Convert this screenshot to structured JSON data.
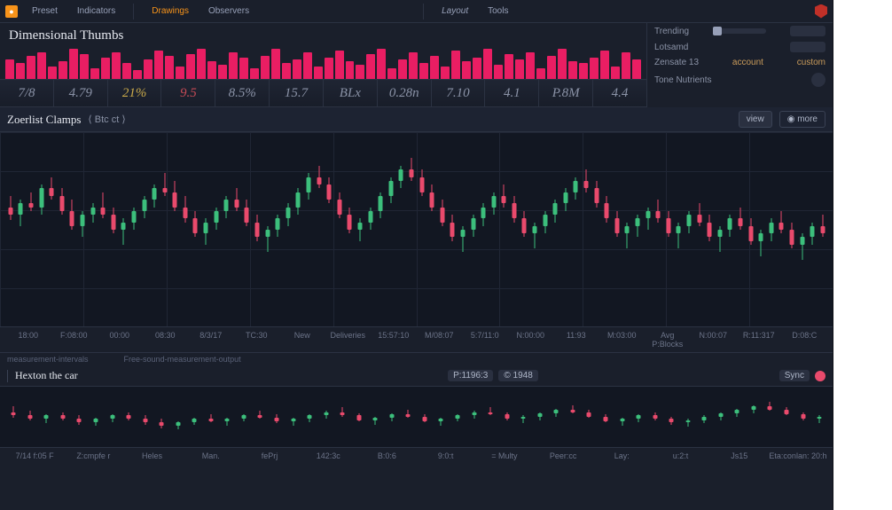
{
  "nav": {
    "items": [
      "Preset",
      "Indicators",
      "Drawings",
      "Observers"
    ],
    "right": [
      "Layout",
      "Tools"
    ]
  },
  "title": "Dimensional Thumbs",
  "side": {
    "rows": [
      "Trending",
      "Lotsamd",
      "Zensate 13",
      "Tone Nutrients"
    ],
    "links": [
      "account",
      "custom"
    ]
  },
  "tickers": [
    "7/8",
    "4.79",
    "21%",
    "9.5",
    "8.5%",
    "15.7",
    "BLx",
    "0.28n",
    "7.10",
    "4.1",
    "P.8M",
    "4.4"
  ],
  "toolbar": {
    "title": "Zoerlist Clamps",
    "center": "⟨ Btc ct ⟩",
    "view_btn": "view",
    "more_btn": "◉ more"
  },
  "xlabels": [
    "18:00",
    "F:08:00",
    "00:00",
    "08:30",
    "8/3/17",
    "TC:30",
    "New",
    "Deliveries",
    "15:57:10",
    "M/08:07",
    "5:7/11:0",
    "N:00:00",
    "11:93",
    "M:03:00",
    "Avg P:Blocks",
    "N:00:07",
    "R:11:317",
    "D:08:C"
  ],
  "footnote": {
    "left": "measurement-intervals",
    "right": "Free-sound-measurement-output"
  },
  "sec": {
    "title": "Hexton the car",
    "tags": [
      "P:1196:3",
      "© 1948"
    ],
    "btn": "Sync"
  },
  "bottom_labels": [
    "7/14  f:05  F",
    "Z:cmpfe r",
    "Heles",
    "Man.",
    "fePrj",
    "142:3c",
    "B:0:6",
    "9:0:t",
    "= Multy",
    "Peer:cc",
    "Lay:",
    "u:2:t",
    "Js15",
    "Eta:conlan: 20:h"
  ],
  "chart_data": {
    "histogram": [
      22,
      18,
      26,
      30,
      14,
      20,
      34,
      28,
      12,
      24,
      30,
      18,
      10,
      22,
      32,
      26,
      14,
      28,
      34,
      20,
      16,
      30,
      24,
      12,
      26,
      34,
      18,
      22,
      30,
      14,
      24,
      32,
      20,
      16,
      28,
      34,
      12,
      22,
      30,
      18,
      26,
      14,
      32,
      20,
      24,
      34,
      16,
      28,
      22,
      30,
      12,
      26,
      34,
      20,
      18,
      24,
      32,
      14,
      30,
      22
    ],
    "main_candles": {
      "type": "candlestick",
      "yrange": [
        0,
        100
      ],
      "data": [
        {
          "o": 62,
          "h": 68,
          "l": 55,
          "c": 58,
          "up": false
        },
        {
          "o": 58,
          "h": 66,
          "l": 52,
          "c": 64,
          "up": true
        },
        {
          "o": 64,
          "h": 70,
          "l": 60,
          "c": 62,
          "up": false
        },
        {
          "o": 62,
          "h": 74,
          "l": 58,
          "c": 72,
          "up": true
        },
        {
          "o": 72,
          "h": 78,
          "l": 66,
          "c": 68,
          "up": false
        },
        {
          "o": 68,
          "h": 72,
          "l": 58,
          "c": 60,
          "up": false
        },
        {
          "o": 60,
          "h": 66,
          "l": 50,
          "c": 52,
          "up": false
        },
        {
          "o": 52,
          "h": 60,
          "l": 46,
          "c": 58,
          "up": true
        },
        {
          "o": 58,
          "h": 64,
          "l": 54,
          "c": 62,
          "up": true
        },
        {
          "o": 62,
          "h": 70,
          "l": 56,
          "c": 58,
          "up": false
        },
        {
          "o": 58,
          "h": 62,
          "l": 48,
          "c": 50,
          "up": false
        },
        {
          "o": 50,
          "h": 56,
          "l": 42,
          "c": 54,
          "up": true
        },
        {
          "o": 54,
          "h": 62,
          "l": 50,
          "c": 60,
          "up": true
        },
        {
          "o": 60,
          "h": 68,
          "l": 56,
          "c": 66,
          "up": true
        },
        {
          "o": 66,
          "h": 74,
          "l": 62,
          "c": 72,
          "up": true
        },
        {
          "o": 72,
          "h": 80,
          "l": 68,
          "c": 70,
          "up": false
        },
        {
          "o": 70,
          "h": 76,
          "l": 60,
          "c": 62,
          "up": false
        },
        {
          "o": 62,
          "h": 68,
          "l": 54,
          "c": 56,
          "up": false
        },
        {
          "o": 56,
          "h": 60,
          "l": 46,
          "c": 48,
          "up": false
        },
        {
          "o": 48,
          "h": 56,
          "l": 42,
          "c": 54,
          "up": true
        },
        {
          "o": 54,
          "h": 62,
          "l": 50,
          "c": 60,
          "up": true
        },
        {
          "o": 60,
          "h": 68,
          "l": 56,
          "c": 66,
          "up": true
        },
        {
          "o": 66,
          "h": 72,
          "l": 60,
          "c": 62,
          "up": false
        },
        {
          "o": 62,
          "h": 66,
          "l": 52,
          "c": 54,
          "up": false
        },
        {
          "o": 54,
          "h": 58,
          "l": 44,
          "c": 46,
          "up": false
        },
        {
          "o": 46,
          "h": 52,
          "l": 38,
          "c": 50,
          "up": true
        },
        {
          "o": 50,
          "h": 58,
          "l": 46,
          "c": 56,
          "up": true
        },
        {
          "o": 56,
          "h": 64,
          "l": 52,
          "c": 62,
          "up": true
        },
        {
          "o": 62,
          "h": 72,
          "l": 58,
          "c": 70,
          "up": true
        },
        {
          "o": 70,
          "h": 80,
          "l": 66,
          "c": 78,
          "up": true
        },
        {
          "o": 78,
          "h": 84,
          "l": 72,
          "c": 74,
          "up": false
        },
        {
          "o": 74,
          "h": 78,
          "l": 64,
          "c": 66,
          "up": false
        },
        {
          "o": 66,
          "h": 70,
          "l": 56,
          "c": 58,
          "up": false
        },
        {
          "o": 58,
          "h": 62,
          "l": 48,
          "c": 50,
          "up": false
        },
        {
          "o": 50,
          "h": 56,
          "l": 44,
          "c": 54,
          "up": true
        },
        {
          "o": 54,
          "h": 62,
          "l": 50,
          "c": 60,
          "up": true
        },
        {
          "o": 60,
          "h": 70,
          "l": 56,
          "c": 68,
          "up": true
        },
        {
          "o": 68,
          "h": 78,
          "l": 64,
          "c": 76,
          "up": true
        },
        {
          "o": 76,
          "h": 84,
          "l": 72,
          "c": 82,
          "up": true
        },
        {
          "o": 82,
          "h": 88,
          "l": 76,
          "c": 78,
          "up": false
        },
        {
          "o": 78,
          "h": 82,
          "l": 68,
          "c": 70,
          "up": false
        },
        {
          "o": 70,
          "h": 74,
          "l": 60,
          "c": 62,
          "up": false
        },
        {
          "o": 62,
          "h": 66,
          "l": 52,
          "c": 54,
          "up": false
        },
        {
          "o": 54,
          "h": 58,
          "l": 44,
          "c": 46,
          "up": false
        },
        {
          "o": 46,
          "h": 52,
          "l": 38,
          "c": 50,
          "up": true
        },
        {
          "o": 50,
          "h": 58,
          "l": 46,
          "c": 56,
          "up": true
        },
        {
          "o": 56,
          "h": 64,
          "l": 52,
          "c": 62,
          "up": true
        },
        {
          "o": 62,
          "h": 70,
          "l": 58,
          "c": 68,
          "up": true
        },
        {
          "o": 68,
          "h": 74,
          "l": 62,
          "c": 64,
          "up": false
        },
        {
          "o": 64,
          "h": 68,
          "l": 54,
          "c": 56,
          "up": false
        },
        {
          "o": 56,
          "h": 60,
          "l": 46,
          "c": 48,
          "up": false
        },
        {
          "o": 48,
          "h": 54,
          "l": 40,
          "c": 52,
          "up": true
        },
        {
          "o": 52,
          "h": 60,
          "l": 48,
          "c": 58,
          "up": true
        },
        {
          "o": 58,
          "h": 66,
          "l": 54,
          "c": 64,
          "up": true
        },
        {
          "o": 64,
          "h": 72,
          "l": 60,
          "c": 70,
          "up": true
        },
        {
          "o": 70,
          "h": 78,
          "l": 66,
          "c": 76,
          "up": true
        },
        {
          "o": 76,
          "h": 82,
          "l": 70,
          "c": 72,
          "up": false
        },
        {
          "o": 72,
          "h": 76,
          "l": 62,
          "c": 64,
          "up": false
        },
        {
          "o": 64,
          "h": 68,
          "l": 54,
          "c": 56,
          "up": false
        },
        {
          "o": 56,
          "h": 60,
          "l": 46,
          "c": 48,
          "up": false
        },
        {
          "o": 48,
          "h": 54,
          "l": 40,
          "c": 52,
          "up": true
        },
        {
          "o": 52,
          "h": 58,
          "l": 46,
          "c": 56,
          "up": true
        },
        {
          "o": 56,
          "h": 62,
          "l": 50,
          "c": 60,
          "up": true
        },
        {
          "o": 60,
          "h": 66,
          "l": 54,
          "c": 56,
          "up": false
        },
        {
          "o": 56,
          "h": 60,
          "l": 46,
          "c": 48,
          "up": false
        },
        {
          "o": 48,
          "h": 54,
          "l": 40,
          "c": 52,
          "up": true
        },
        {
          "o": 52,
          "h": 60,
          "l": 48,
          "c": 58,
          "up": true
        },
        {
          "o": 58,
          "h": 64,
          "l": 52,
          "c": 54,
          "up": false
        },
        {
          "o": 54,
          "h": 58,
          "l": 44,
          "c": 46,
          "up": false
        },
        {
          "o": 46,
          "h": 52,
          "l": 38,
          "c": 50,
          "up": true
        },
        {
          "o": 50,
          "h": 58,
          "l": 46,
          "c": 56,
          "up": true
        },
        {
          "o": 56,
          "h": 62,
          "l": 50,
          "c": 52,
          "up": false
        },
        {
          "o": 52,
          "h": 56,
          "l": 42,
          "c": 44,
          "up": false
        },
        {
          "o": 44,
          "h": 50,
          "l": 36,
          "c": 48,
          "up": true
        },
        {
          "o": 48,
          "h": 56,
          "l": 44,
          "c": 54,
          "up": true
        },
        {
          "o": 54,
          "h": 60,
          "l": 48,
          "c": 50,
          "up": false
        },
        {
          "o": 50,
          "h": 54,
          "l": 40,
          "c": 42,
          "up": false
        },
        {
          "o": 42,
          "h": 48,
          "l": 34,
          "c": 46,
          "up": true
        },
        {
          "o": 46,
          "h": 54,
          "l": 42,
          "c": 52,
          "up": true
        },
        {
          "o": 52,
          "h": 58,
          "l": 46,
          "c": 48,
          "up": false
        }
      ]
    },
    "sec_candles": {
      "type": "candlestick",
      "yrange": [
        0,
        100
      ],
      "data": [
        {
          "o": 60,
          "h": 70,
          "l": 50,
          "c": 55,
          "up": false
        },
        {
          "o": 55,
          "h": 62,
          "l": 45,
          "c": 48,
          "up": false
        },
        {
          "o": 48,
          "h": 56,
          "l": 40,
          "c": 54,
          "up": true
        },
        {
          "o": 54,
          "h": 60,
          "l": 46,
          "c": 48,
          "up": false
        },
        {
          "o": 48,
          "h": 54,
          "l": 38,
          "c": 42,
          "up": false
        },
        {
          "o": 42,
          "h": 50,
          "l": 36,
          "c": 48,
          "up": true
        },
        {
          "o": 48,
          "h": 56,
          "l": 42,
          "c": 54,
          "up": true
        },
        {
          "o": 54,
          "h": 60,
          "l": 46,
          "c": 48,
          "up": false
        },
        {
          "o": 48,
          "h": 54,
          "l": 38,
          "c": 42,
          "up": false
        },
        {
          "o": 42,
          "h": 48,
          "l": 32,
          "c": 36,
          "up": false
        },
        {
          "o": 36,
          "h": 44,
          "l": 30,
          "c": 42,
          "up": true
        },
        {
          "o": 42,
          "h": 50,
          "l": 38,
          "c": 48,
          "up": true
        },
        {
          "o": 48,
          "h": 56,
          "l": 42,
          "c": 44,
          "up": false
        },
        {
          "o": 44,
          "h": 50,
          "l": 36,
          "c": 48,
          "up": true
        },
        {
          "o": 48,
          "h": 56,
          "l": 44,
          "c": 54,
          "up": true
        },
        {
          "o": 54,
          "h": 62,
          "l": 48,
          "c": 50,
          "up": false
        },
        {
          "o": 50,
          "h": 56,
          "l": 40,
          "c": 44,
          "up": false
        },
        {
          "o": 44,
          "h": 50,
          "l": 36,
          "c": 48,
          "up": true
        },
        {
          "o": 48,
          "h": 56,
          "l": 42,
          "c": 54,
          "up": true
        },
        {
          "o": 54,
          "h": 62,
          "l": 48,
          "c": 60,
          "up": true
        },
        {
          "o": 60,
          "h": 68,
          "l": 52,
          "c": 54,
          "up": false
        },
        {
          "o": 54,
          "h": 58,
          "l": 44,
          "c": 46,
          "up": false
        },
        {
          "o": 46,
          "h": 52,
          "l": 38,
          "c": 50,
          "up": true
        },
        {
          "o": 50,
          "h": 58,
          "l": 44,
          "c": 56,
          "up": true
        },
        {
          "o": 56,
          "h": 64,
          "l": 50,
          "c": 52,
          "up": false
        },
        {
          "o": 52,
          "h": 56,
          "l": 42,
          "c": 44,
          "up": false
        },
        {
          "o": 44,
          "h": 50,
          "l": 36,
          "c": 48,
          "up": true
        },
        {
          "o": 48,
          "h": 56,
          "l": 44,
          "c": 54,
          "up": true
        },
        {
          "o": 54,
          "h": 62,
          "l": 48,
          "c": 60,
          "up": true
        },
        {
          "o": 60,
          "h": 68,
          "l": 54,
          "c": 56,
          "up": false
        },
        {
          "o": 56,
          "h": 60,
          "l": 46,
          "c": 48,
          "up": false
        },
        {
          "o": 48,
          "h": 54,
          "l": 40,
          "c": 52,
          "up": true
        },
        {
          "o": 52,
          "h": 60,
          "l": 46,
          "c": 58,
          "up": true
        },
        {
          "o": 58,
          "h": 66,
          "l": 52,
          "c": 64,
          "up": true
        },
        {
          "o": 64,
          "h": 72,
          "l": 58,
          "c": 60,
          "up": false
        },
        {
          "o": 60,
          "h": 64,
          "l": 50,
          "c": 52,
          "up": false
        },
        {
          "o": 52,
          "h": 56,
          "l": 42,
          "c": 44,
          "up": false
        },
        {
          "o": 44,
          "h": 50,
          "l": 36,
          "c": 48,
          "up": true
        },
        {
          "o": 48,
          "h": 56,
          "l": 42,
          "c": 54,
          "up": true
        },
        {
          "o": 54,
          "h": 60,
          "l": 46,
          "c": 48,
          "up": false
        },
        {
          "o": 48,
          "h": 52,
          "l": 38,
          "c": 42,
          "up": false
        },
        {
          "o": 42,
          "h": 48,
          "l": 34,
          "c": 46,
          "up": true
        },
        {
          "o": 46,
          "h": 54,
          "l": 40,
          "c": 52,
          "up": true
        },
        {
          "o": 52,
          "h": 60,
          "l": 46,
          "c": 58,
          "up": true
        },
        {
          "o": 58,
          "h": 66,
          "l": 52,
          "c": 64,
          "up": true
        },
        {
          "o": 64,
          "h": 72,
          "l": 58,
          "c": 70,
          "up": true
        },
        {
          "o": 70,
          "h": 78,
          "l": 62,
          "c": 64,
          "up": false
        },
        {
          "o": 64,
          "h": 68,
          "l": 54,
          "c": 56,
          "up": false
        },
        {
          "o": 56,
          "h": 60,
          "l": 46,
          "c": 48,
          "up": false
        },
        {
          "o": 48,
          "h": 54,
          "l": 40,
          "c": 52,
          "up": true
        }
      ]
    }
  }
}
